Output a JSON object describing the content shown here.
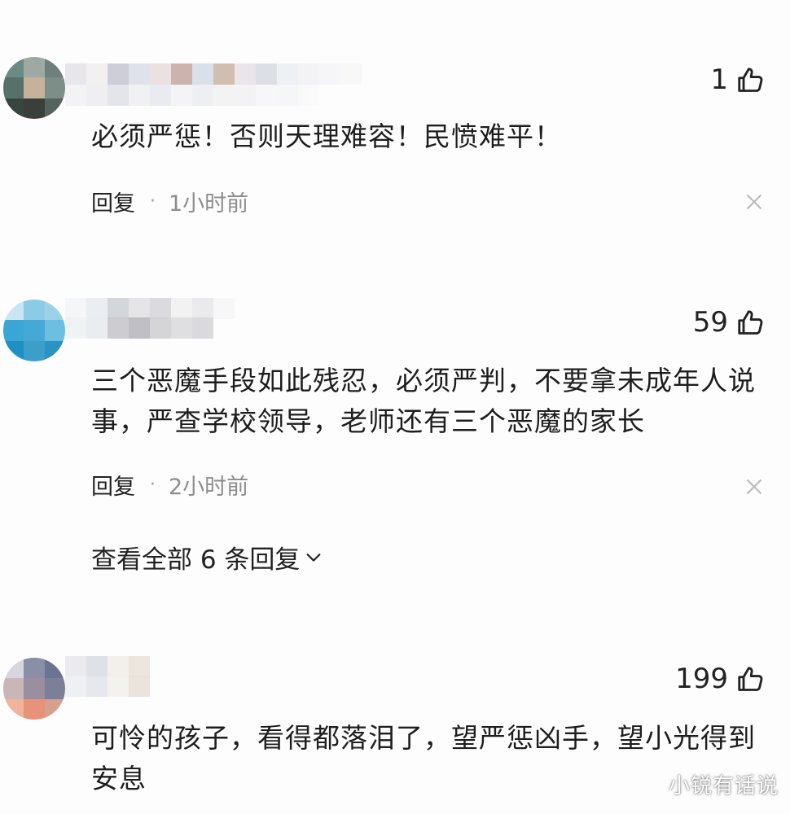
{
  "comments": [
    {
      "text": "必须严惩！否则天理难容！民愤难平！",
      "likes": "1",
      "reply_label": "回复",
      "dot": "·",
      "time": "1小时前"
    },
    {
      "text": "三个恶魔手段如此残忍，必须严判，不要拿未成年人说事，严查学校领导，老师还有三个恶魔的家长",
      "likes": "59",
      "reply_label": "回复",
      "dot": "·",
      "time": "2小时前",
      "view_replies": "查看全部 6 条回复"
    },
    {
      "text": "可怜的孩子，看得都落泪了，望严惩凶手，望小光得到安息",
      "likes": "199"
    }
  ],
  "watermark": "小锐有话说",
  "icons": {
    "like": "thumbs-up-icon",
    "close": "close-icon",
    "expand": "chevron-down-icon"
  },
  "colors": {
    "background": "#fdfdfd",
    "text": "#1e1e1e",
    "secondary": "#8d8d8d",
    "close": "#b9b9b9"
  }
}
